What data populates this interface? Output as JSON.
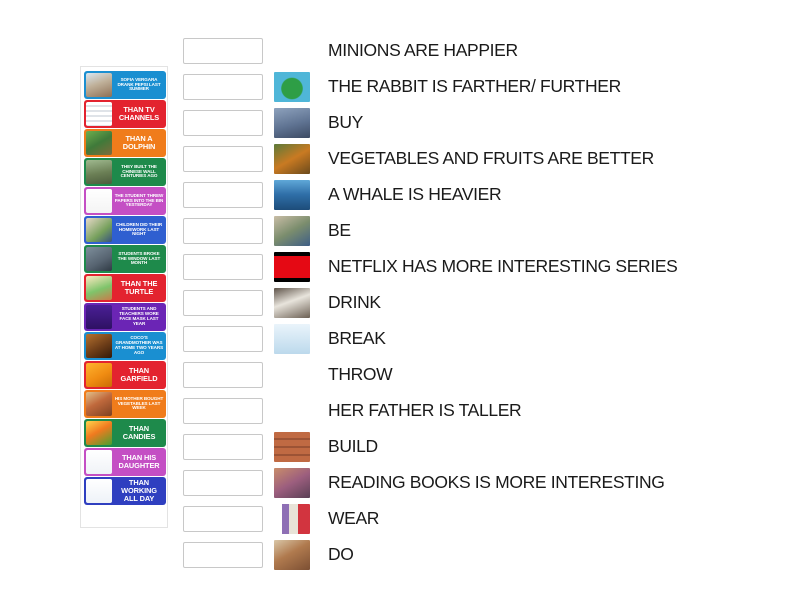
{
  "activity": {
    "type": "match-up",
    "left_column_label": "tile-bank",
    "box_count": 15
  },
  "tiles": [
    {
      "text": "SOFIA VERGARA DRANK PEPSI LAST SUMMER",
      "color": "#1a8fd1",
      "size": "small",
      "thumb": "woman-standing-photo"
    },
    {
      "text": "THAN TV CHANNELS",
      "color": "#e3232f",
      "size": "big",
      "thumb": "tv-listing-photo"
    },
    {
      "text": "THAN A DOLPHIN",
      "color": "#f07c1b",
      "size": "big",
      "thumb": "turtle-photo"
    },
    {
      "text": "THEY BUILT THE CHINESE WALL CENTURIES AGO",
      "color": "#1e8a4b",
      "size": "small",
      "thumb": "great-wall-photo"
    },
    {
      "text": "THE STUDENT THREW PAPERS INTO THE BIN YESTERDAY",
      "color": "#c44fc4",
      "size": "small",
      "thumb": "line-drawing-classroom"
    },
    {
      "text": "CHILDREN DID THEIR HOMEWORK LAST NIGHT",
      "color": "#2f5fd0",
      "size": "small",
      "thumb": "children-homework-photo"
    },
    {
      "text": "STUDENTS BROKE THE WINDOW LAST MONTH",
      "color": "#1e8a4b",
      "size": "small",
      "thumb": "broken-window-photo"
    },
    {
      "text": "THAN THE TURTLE",
      "color": "#e3232f",
      "size": "big",
      "thumb": "turtle-illustration"
    },
    {
      "text": "STUDENTS AND TEACHERS WORE FACE MASK LAST YEAR",
      "color": "#6b25b5",
      "size": "small",
      "thumb": "masked-kids-icon"
    },
    {
      "text": "COCO'S GRANDMOTHER WAS AT HOME TWO YEARS AGO",
      "color": "#1a8fd1",
      "size": "small",
      "thumb": "grandmother-photo"
    },
    {
      "text": "THAN GARFIELD",
      "color": "#e3232f",
      "size": "big",
      "thumb": "garfield-cat-image"
    },
    {
      "text": "HIS MOTHER BOUGHT VEGETABLES LAST WEEK",
      "color": "#f07c1b",
      "size": "small",
      "thumb": "market-vegetables-photo"
    },
    {
      "text": "THAN CANDIES",
      "color": "#1e8a4b",
      "size": "big",
      "thumb": "fruits-photo"
    },
    {
      "text": "THAN HIS DAUGHTER",
      "color": "#c44fc4",
      "size": "big",
      "thumb": "father-daughter-drawing"
    },
    {
      "text": "THAN WORKING ALL DAY",
      "color": "#2f3fc0",
      "size": "big",
      "thumb": "woman-relaxing-drawing"
    }
  ],
  "rows": [
    {
      "label": "MINIONS  ARE HAPPIER",
      "thumb": "minions-cartoon"
    },
    {
      "label": "THE RABBIT IS FARTHER/ FURTHER",
      "thumb": "map-island-illustration"
    },
    {
      "label": "BUY",
      "thumb": "wallet-money-photo"
    },
    {
      "label": "VEGETABLES AND FRUITS ARE BETTER",
      "thumb": "child-eating-carrot-photo"
    },
    {
      "label": "A WHALE IS HEAVIER",
      "thumb": "whale-photo"
    },
    {
      "label": "BE",
      "thumb": "person-market-photo"
    },
    {
      "label": "NETFLIX HAS MORE INTERESTING SERIES",
      "thumb": "netflix-logo"
    },
    {
      "label": "DRINK",
      "thumb": "milk-glass-photo"
    },
    {
      "label": "BREAK",
      "thumb": "broken-window-icon"
    },
    {
      "label": "THROW",
      "thumb": "boy-trash-cartoon"
    },
    {
      "label": "HER FATHER IS TALLER",
      "thumb": "father-daughter-illustration"
    },
    {
      "label": "BUILD",
      "thumb": "brick-wall-photo"
    },
    {
      "label": "READING BOOKS IS MORE INTERESTING",
      "thumb": "children-reading-photo"
    },
    {
      "label": "WEAR",
      "thumb": "clothes-photo"
    },
    {
      "label": "DO",
      "thumb": "children-crafts-photo"
    }
  ]
}
